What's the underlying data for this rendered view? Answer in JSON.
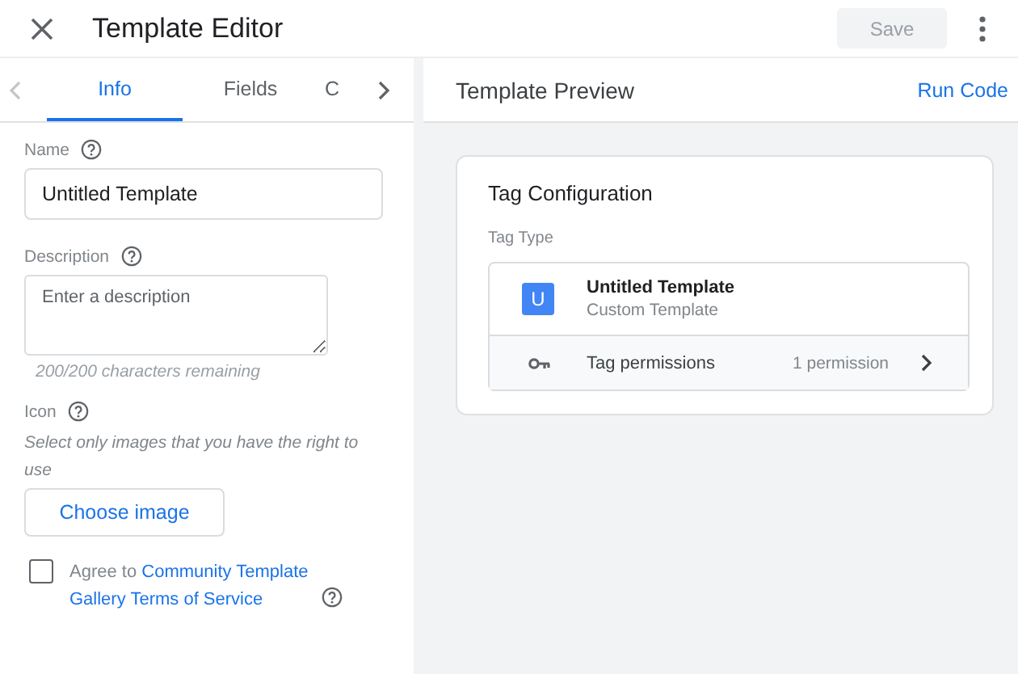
{
  "header": {
    "title": "Template Editor",
    "save_button": {
      "label": "Save",
      "disabled": true
    }
  },
  "tabs": [
    {
      "label": "Info",
      "selected": true
    },
    {
      "label": "Fields",
      "selected": false
    },
    {
      "label": "C",
      "selected": false
    }
  ],
  "form": {
    "name": {
      "label": "Name",
      "value": "Untitled Template"
    },
    "description": {
      "label": "Description",
      "placeholder": "Enter a description",
      "counter": "200/200 characters remaining"
    },
    "icon": {
      "label": "Icon",
      "hint": "Select only images that you have the right to use",
      "button": "Choose image"
    },
    "agree": {
      "checked": false,
      "prefix": "Agree to",
      "link": "Community Template Gallery Terms of Service"
    }
  },
  "preview": {
    "title": "Template Preview",
    "run_button": "Run Code",
    "card": {
      "title": "Tag Configuration",
      "tag_type_label": "Tag Type",
      "tag": {
        "badge": "U",
        "name": "Untitled Template",
        "subtitle": "Custom Template"
      },
      "permissions": {
        "label": "Tag permissions",
        "count": "1 permission"
      }
    }
  }
}
